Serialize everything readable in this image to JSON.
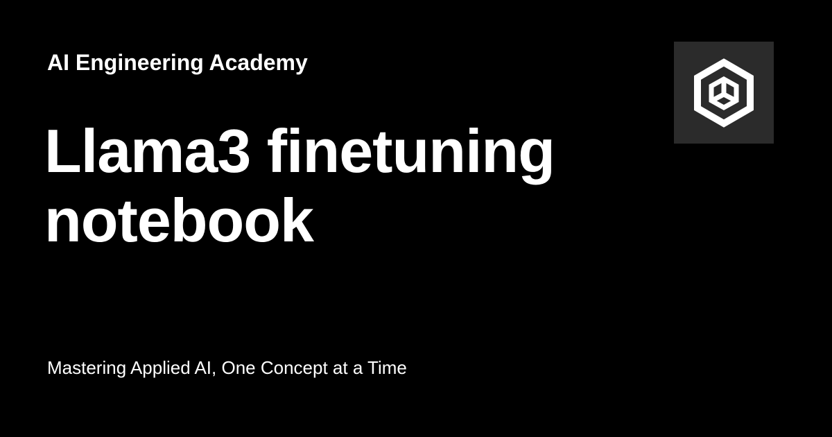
{
  "site_name": "AI Engineering Academy",
  "title_lines": [
    "Llama3 finetuning",
    "notebook"
  ],
  "tagline": "Mastering Applied AI, One Concept at a Time",
  "logo": {
    "icon": "hexagon-cube-logo-icon",
    "background": "#2b2b2b",
    "foreground": "#ffffff"
  },
  "colors": {
    "background": "#000000",
    "text": "#ffffff"
  }
}
